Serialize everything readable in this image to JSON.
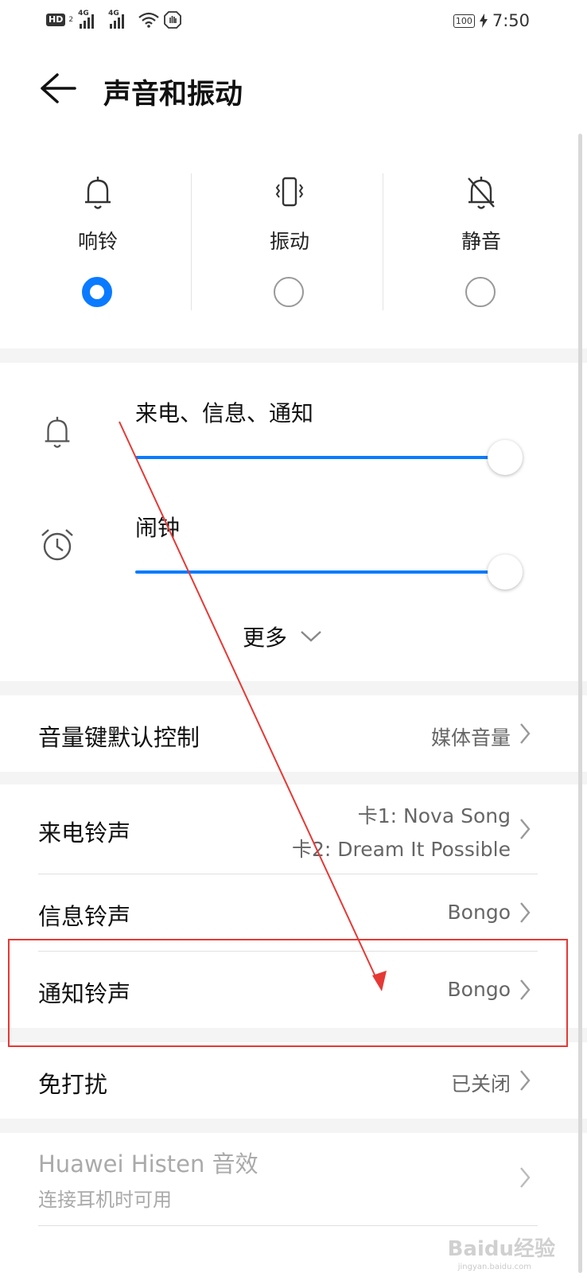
{
  "status_bar": {
    "hd_badge": "HD",
    "hd_index": "2",
    "sim1_tag": "4G",
    "sim2_tag": "4G",
    "battery": "100",
    "time": "7:50"
  },
  "header": {
    "title": "声音和振动"
  },
  "modes": [
    {
      "label": "响铃",
      "selected": true
    },
    {
      "label": "振动",
      "selected": false
    },
    {
      "label": "静音",
      "selected": false
    }
  ],
  "volume": {
    "ring": {
      "label": "来电、信息、通知",
      "level": 1.0
    },
    "alarm": {
      "label": "闹钟",
      "level": 1.0
    },
    "more_label": "更多"
  },
  "settings": {
    "volume_key": {
      "label": "音量键默认控制",
      "value": "媒体音量"
    },
    "call_ringtone": {
      "label": "来电铃声",
      "value_line1": "卡1: Nova Song",
      "value_line2": "卡2: Dream It Possible"
    },
    "message_ringtone": {
      "label": "信息铃声",
      "value": "Bongo"
    },
    "notification_ringtone": {
      "label": "通知铃声",
      "value": "Bongo"
    },
    "dnd": {
      "label": "免打扰",
      "value": "已关闭"
    },
    "histen": {
      "label": "Huawei Histen 音效",
      "sub": "连接耳机时可用"
    }
  },
  "colors": {
    "accent": "#0a7bff",
    "annotation": "#e53935"
  },
  "watermark": {
    "text": "Baidu经验",
    "sub": "jingyan.baidu.com"
  }
}
